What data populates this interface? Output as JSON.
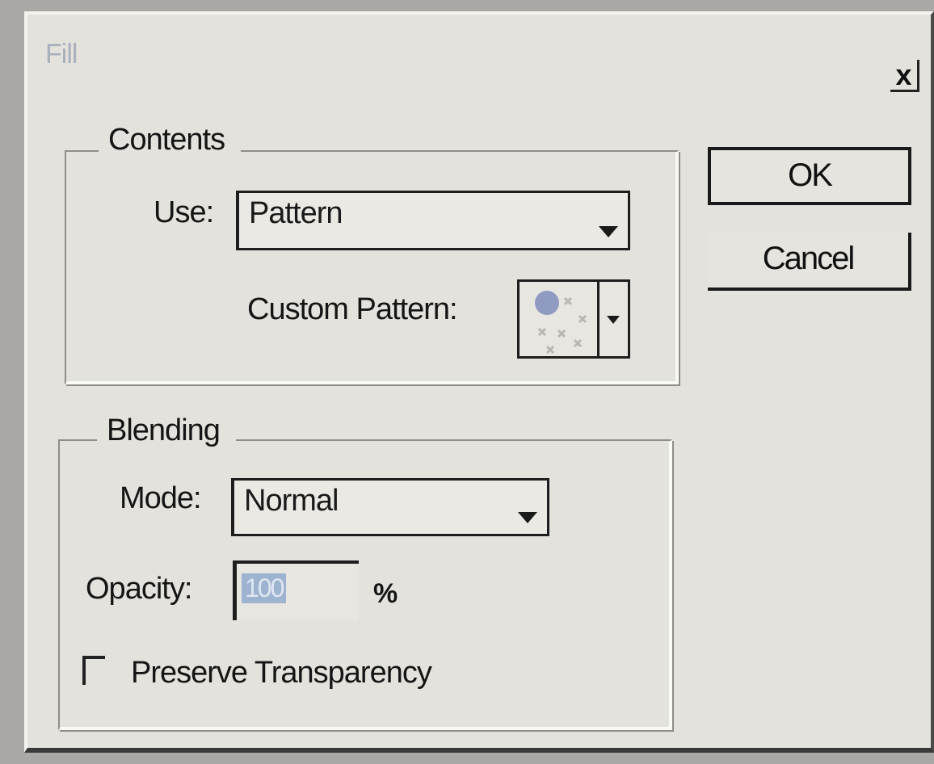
{
  "window": {
    "title": "Fill",
    "close_glyph": "x"
  },
  "contents": {
    "legend": "Contents",
    "use_label": "Use:",
    "use_value": "Pattern",
    "custom_pattern_label": "Custom Pattern:"
  },
  "blending": {
    "legend": "Blending",
    "mode_label": "Mode:",
    "mode_value": "Normal",
    "opacity_label": "Opacity:",
    "opacity_value": "100",
    "opacity_unit": "%",
    "preserve_transparency_label": "Preserve Transparency",
    "preserve_transparency_checked": false
  },
  "buttons": {
    "ok_label": "OK",
    "cancel_label": "Cancel"
  },
  "icons": {
    "dropdown_arrow": "chevron-down-icon",
    "close": "close-icon"
  }
}
